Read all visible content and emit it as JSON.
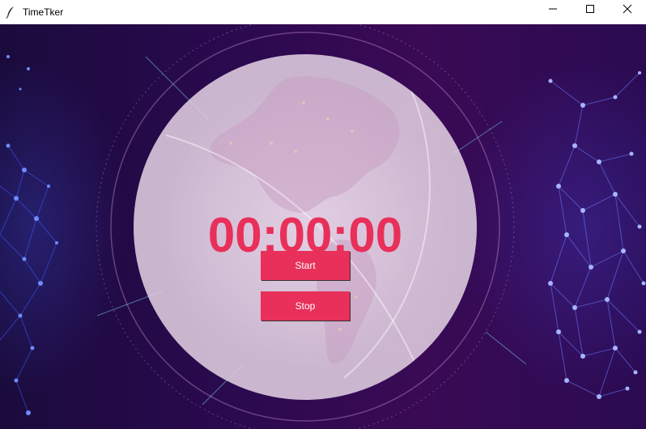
{
  "window": {
    "title": "TimeTker",
    "controls": {
      "minimize_icon": "minimize-icon",
      "maximize_icon": "maximize-icon",
      "close_icon": "close-icon"
    }
  },
  "timer": {
    "display": "00:00:00",
    "color": "#e8305a"
  },
  "buttons": {
    "start_label": "Start",
    "stop_label": "Stop",
    "color": "#e8305a"
  },
  "background": {
    "description_icon": "globe-network-background"
  }
}
